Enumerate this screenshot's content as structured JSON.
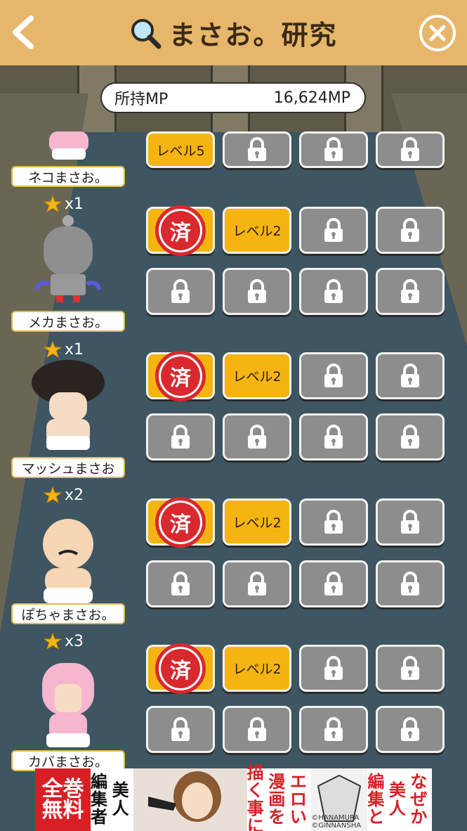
{
  "header": {
    "title": "まさお。研究"
  },
  "mp": {
    "label": "所持MP",
    "value": "16,624MP"
  },
  "rows": [
    {
      "name": "ネコまさお。",
      "tiles": [
        "レベル5",
        "",
        "",
        ""
      ]
    },
    {
      "name": "メカまさお。",
      "stars": "x1",
      "tiles": [
        "済",
        "レベル2",
        "",
        "",
        "",
        "",
        "",
        ""
      ]
    },
    {
      "name": "マッシュまさお",
      "stars": "x1",
      "tiles": [
        "済",
        "レベル2",
        "",
        "",
        "",
        "",
        "",
        ""
      ]
    },
    {
      "name": "ぽちゃまさお。",
      "stars": "x2",
      "tiles": [
        "済",
        "レベル2",
        "",
        "",
        "",
        "",
        "",
        ""
      ]
    },
    {
      "name": "カバまさお。",
      "stars": "x3",
      "tiles": [
        "済",
        "レベル2",
        "",
        "",
        "",
        "",
        "",
        ""
      ]
    }
  ],
  "ad": {
    "badge_top": "全巻",
    "badge_bottom": "無料",
    "col1": "編集者",
    "col2": "美人",
    "col3": "描く事に",
    "col4": "漫画を",
    "col5": "エロい",
    "col6": "編集と",
    "col7": "美人",
    "col8": "なぜか",
    "copyright": "©HANAMURA ©GINNANSHA"
  },
  "colors": {
    "header": "#e6b66a",
    "done": "#d9282e",
    "level": "#f5b412",
    "locked": "#8d8d8d"
  },
  "icons": [
    "back-arrow-icon",
    "magnifier-icon",
    "close-icon",
    "lock-icon",
    "star-icon"
  ]
}
